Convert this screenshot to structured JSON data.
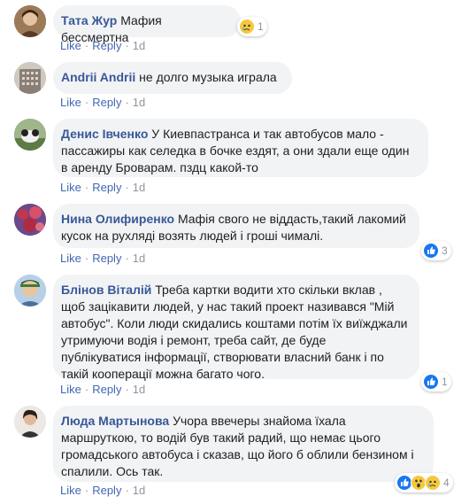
{
  "actions": {
    "like": "Like",
    "reply": "Reply",
    "separator": "·"
  },
  "comments": [
    {
      "author": "Тата Жур",
      "text": "Мафия бессмертна",
      "time": "1d",
      "reactions": {
        "icons": [
          "sad-icon"
        ],
        "count": "1"
      }
    },
    {
      "author": "Andrii Andrii",
      "text": "не долго музыка играла",
      "time": "1d"
    },
    {
      "author": "Денис Івченко",
      "text": "У Киевпастранса и так автобусов мало - пассажиры как селедка в бочке ездят, а они здали еще один в аренду Броварам. пздц какой-то",
      "time": "1d"
    },
    {
      "author": "Нина Олифиренко",
      "text": "Мафія свого не віддасть,такий лакомий кусок на рухляді возять людей і гроші чималі.",
      "time": "1d",
      "reactions": {
        "icons": [
          "like-icon"
        ],
        "count": "3"
      }
    },
    {
      "author": "Блінов Віталій",
      "text": "Треба картки водити хто скільки вклав , щоб зацікавити людей, у нас такий проект називався \"Мій автобус\". Коли люди скидались коштами потім їх виїжджали утримуючи водія і ремонт, треба сайт, де буде публікуватися інформації, створювати власний банк і по такій кооперації можна багато чого.",
      "time": "1d",
      "reactions": {
        "icons": [
          "like-icon"
        ],
        "count": "1"
      }
    },
    {
      "author": "Люда Мартынова",
      "text": "Учора ввечеры знайома їхала маршруткою, то водій був такий радий, що немає цього громадського автобуса і сказав, що його б облили бензином і спалили. Ось так.",
      "time": "1d",
      "reactions": {
        "icons": [
          "like-icon",
          "wow-icon",
          "sad-icon"
        ],
        "count": "4"
      }
    }
  ],
  "colors": {
    "author": "#385898",
    "link": "#4267b2",
    "meta": "#90949c",
    "bubble": "#f2f3f5",
    "like_blue": "#1877f2",
    "emoji_yellow": "#f7c83c"
  }
}
